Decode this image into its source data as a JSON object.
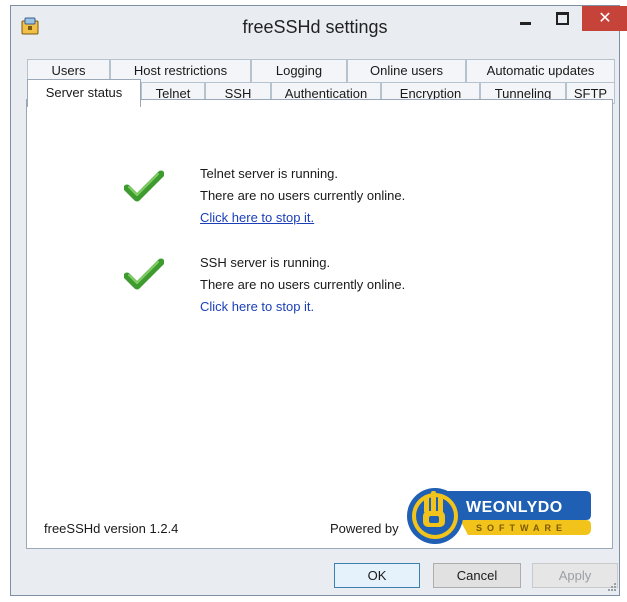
{
  "window": {
    "title": "freeSSHd settings",
    "close_glyph": "✕"
  },
  "tabs": {
    "row1": [
      "Users",
      "Host restrictions",
      "Logging",
      "Online users",
      "Automatic updates"
    ],
    "row2": [
      "Server status",
      "Telnet",
      "SSH",
      "Authentication",
      "Encryption",
      "Tunneling",
      "SFTP"
    ],
    "selected": "Server status"
  },
  "telnet": {
    "status": "Telnet server is running.",
    "users": "There are no users currently online.",
    "action": "Click here to stop it."
  },
  "ssh": {
    "status": "SSH server is running.",
    "users": "There are no users currently online.",
    "action": "Click here to stop it."
  },
  "footer": {
    "version": "freeSSHd version 1.2.4",
    "powered_by": "Powered by",
    "logo_word": "WEONLYDO",
    "logo_sub": "SOFTWARE"
  },
  "buttons": {
    "ok": "OK",
    "cancel": "Cancel",
    "apply": "Apply"
  },
  "icons": {
    "status": "check-icon",
    "app": "app-icon"
  },
  "colors": {
    "check_green": "#3d9b2f",
    "link_blue": "#1b3fb8",
    "close_red": "#c6433a",
    "logo_blue": "#1f5fb4",
    "logo_yellow": "#f2c31b"
  }
}
